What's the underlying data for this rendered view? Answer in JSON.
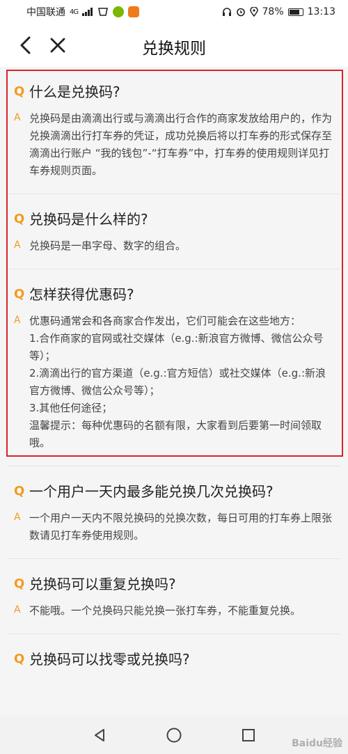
{
  "status_bar": {
    "carrier": "中国联通",
    "network": "4G",
    "battery": "78%",
    "time": "13:13"
  },
  "nav": {
    "title": "兑换规则"
  },
  "faq": [
    {
      "q_mark": "Q",
      "question": "什么是兑换码?",
      "a_mark": "A",
      "answer": "兑换码是由滴滴出行或与滴滴出行合作的商家发放给用户的，作为兑换滴滴出行打车券的凭证，成功兑换后将以打车券的形式保存至滴滴出行账户 “我的钱包”-“打车券”中，打车券的使用规则详见打车券规则页面。"
    },
    {
      "q_mark": "Q",
      "question": "兑换码是什么样的?",
      "a_mark": "A",
      "answer": "兑换码是一串字母、数字的组合。"
    },
    {
      "q_mark": "Q",
      "question": "怎样获得优惠码?",
      "a_mark": "A",
      "answer": "优惠码通常会和各商家合作发出，它们可能会在这些地方：\n1.合作商家的官网或社交媒体（e.g.:新浪官方微博、微信公众号等）；\n2.滴滴出行的官方渠道（e.g.:官方短信）或社交媒体（e.g.:新浪官方微博、微信公众号等）；\n3.其他任何途径；\n温馨提示：每种优惠码的名额有限，大家看到后要第一时间领取哦。"
    },
    {
      "q_mark": "Q",
      "question": "一个用户一天内最多能兑换几次兑换码?",
      "a_mark": "A",
      "answer": "一个用户一天内不限兑换码的兑换次数，每日可用的打车券上限张数请见打车券使用规则。"
    },
    {
      "q_mark": "Q",
      "question": "兑换码可以重复兑换吗?",
      "a_mark": "A",
      "answer": "不能哦。一个兑换码只能兑换一张打车券，不能重复兑换。"
    },
    {
      "q_mark": "Q",
      "question": "兑换码可以找零或兑换吗?",
      "a_mark": "",
      "answer": ""
    }
  ],
  "watermark": "Baidu经验",
  "colors": {
    "accent": "#f39a1e",
    "highlight": "#d8232a"
  }
}
